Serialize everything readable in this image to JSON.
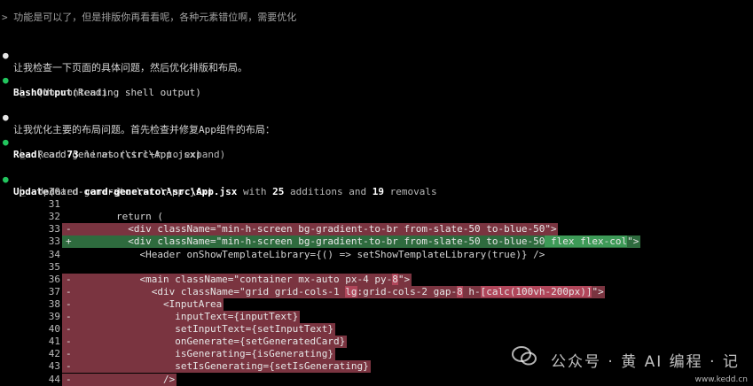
{
  "conversation": {
    "user_prompt": "> 功能是可以了，但是排版你再看看呢，各种元素错位啊，需要优化",
    "msg1": "让我检查一下页面的具体问题，然后优化排版和布局。",
    "tool1": {
      "name": "BashOutput",
      "args": "(Reading shell output)",
      "result": "(No content)"
    },
    "msg2": "让我优化主要的布局问题。首先检查并修复App组件的布局：",
    "tool2": {
      "name": "Read",
      "args": "(card-generator\\src\\App.jsx)",
      "result_prefix": "Read ",
      "result_count": "73",
      "result_suffix": " lines (ctrl+r to expand)"
    },
    "tool3": {
      "name": "Update",
      "args": "(card-generator\\src\\App.jsx)",
      "result_prefix": "Updated ",
      "result_file": "card-generator\\src\\App.jsx",
      "result_mid1": " with ",
      "result_adds": "25",
      "result_mid2": " additions and ",
      "result_rems": "19",
      "result_suffix": " removals"
    }
  },
  "diff": {
    "rows": [
      {
        "num": "30",
        "sign": "",
        "type": "ctx",
        "code": "        }"
      },
      {
        "num": "31",
        "sign": "",
        "type": "ctx",
        "code": ""
      },
      {
        "num": "32",
        "sign": "",
        "type": "ctx",
        "code": "        return ("
      },
      {
        "num": "33",
        "sign": "-",
        "type": "del",
        "code_a": "          <div className=\"min-h-screen bg-gradient-to-br from-slate-50 to-blue-50\">",
        "hl": "",
        "code_b": ""
      },
      {
        "num": "33",
        "sign": "+",
        "type": "add",
        "code_a": "          <div className=\"min-h-screen bg-gradient-to-br from-slate-50 to-blue-50",
        "hl": " flex flex-col",
        "code_b": "\">"
      },
      {
        "num": "34",
        "sign": "",
        "type": "ctx",
        "code": "            <Header onShowTemplateLibrary={() => setShowTemplateLibrary(true)} />"
      },
      {
        "num": "35",
        "sign": "",
        "type": "ctx",
        "code": ""
      },
      {
        "num": "36",
        "sign": "-",
        "type": "del",
        "code_a": "            <main className=\"container mx-auto px-4 py-",
        "hl": "8",
        "code_b": "\">"
      },
      {
        "num": "37",
        "sign": "-",
        "type": "del",
        "code_a": "              <div className=\"grid grid-cols-1 ",
        "hl": "lg",
        "code_b": ":grid-cols-2 gap-",
        "hl2": "8",
        "code_c": " h-",
        "hl3": "[calc(100vh-200px)]",
        "code_d": "\">"
      },
      {
        "num": "38",
        "sign": "-",
        "type": "del",
        "code_a": "                <InputArea",
        "hl": "",
        "code_b": ""
      },
      {
        "num": "39",
        "sign": "-",
        "type": "del",
        "code_a": "                  inputText={inputText}",
        "hl": "",
        "code_b": ""
      },
      {
        "num": "40",
        "sign": "-",
        "type": "del",
        "code_a": "                  setInputText={setInputText}",
        "hl": "",
        "code_b": ""
      },
      {
        "num": "41",
        "sign": "-",
        "type": "del",
        "code_a": "                  onGenerate={setGeneratedCard}",
        "hl": "",
        "code_b": ""
      },
      {
        "num": "42",
        "sign": "-",
        "type": "del",
        "code_a": "                  isGenerating={isGenerating}",
        "hl": "",
        "code_b": ""
      },
      {
        "num": "43",
        "sign": "-",
        "type": "del",
        "code_a": "                  setIsGenerating={setIsGenerating}",
        "hl": "",
        "code_b": ""
      },
      {
        "num": "44",
        "sign": "-",
        "type": "del",
        "code_a": "                />",
        "hl": "",
        "code_b": ""
      }
    ]
  },
  "watermark": {
    "text": "公众号 · 黄 AI 编程 · 记",
    "url": "www.kedd.cn"
  },
  "colors": {
    "background": "#000000",
    "deleted": "#7a3440",
    "added": "#2e6b3e",
    "deleted_highlight": "#b0465a",
    "added_highlight": "#3d9a57",
    "bullet_done": "#22c55e"
  },
  "icons": {
    "bullet": "dot-icon",
    "result_connector": "corner-down-right-icon"
  }
}
